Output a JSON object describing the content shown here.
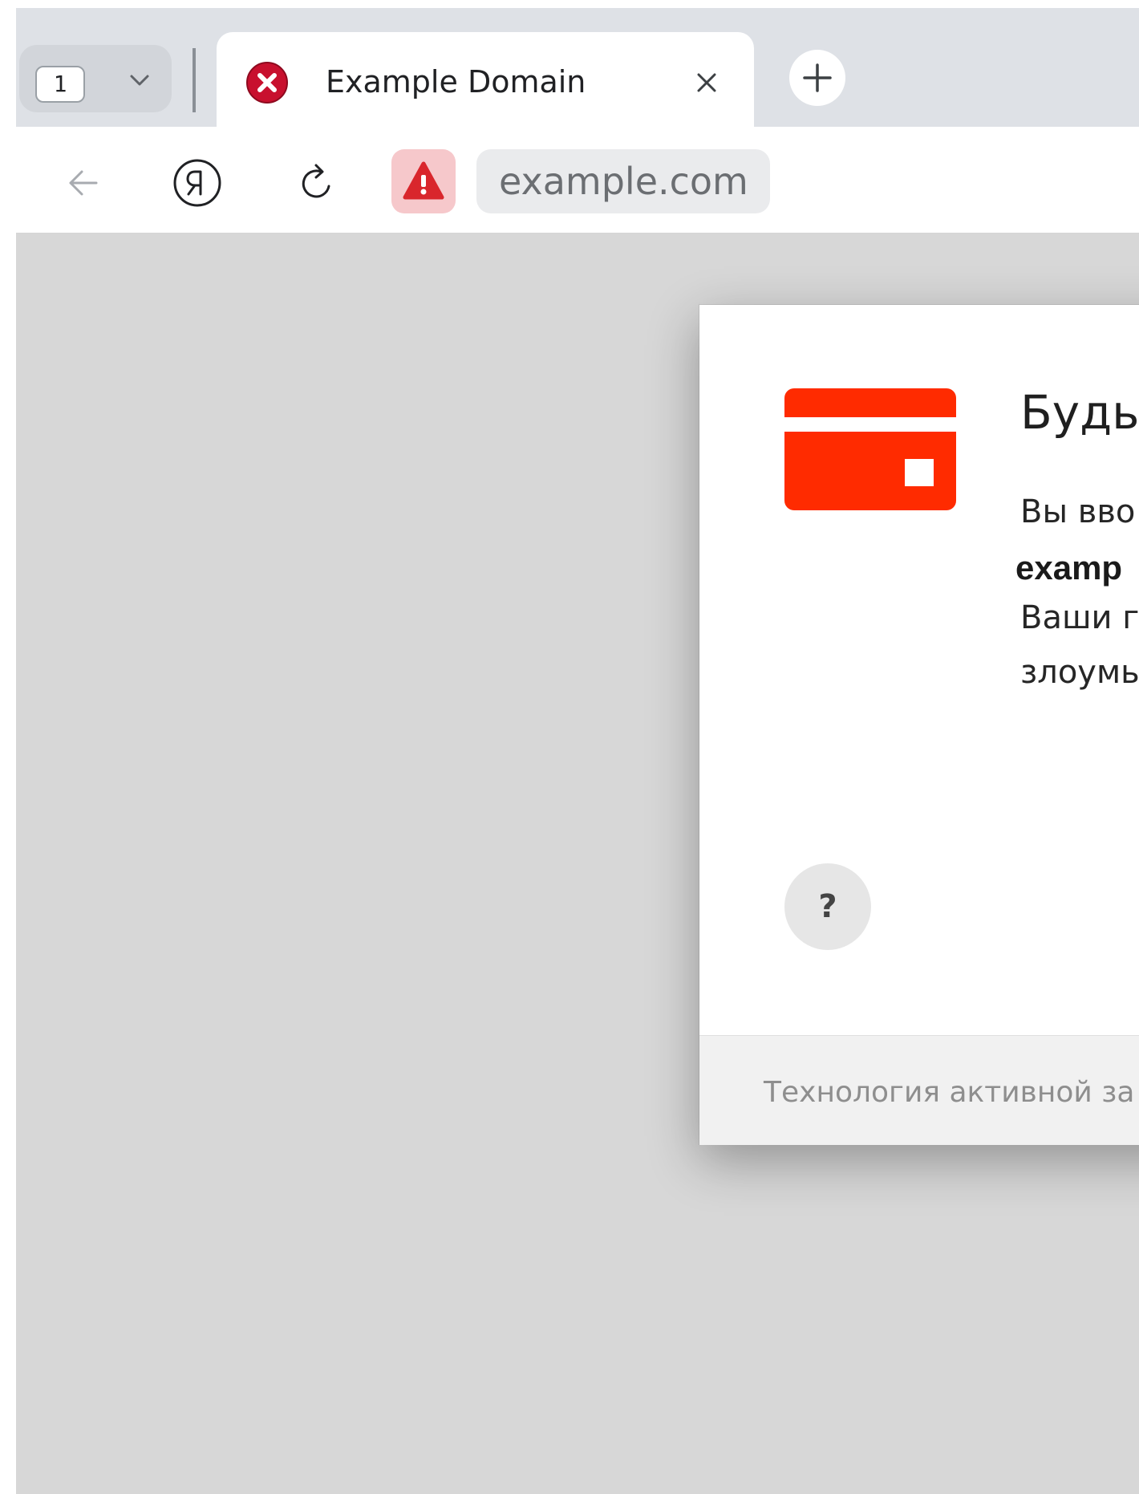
{
  "browser": {
    "tab_counter": "1",
    "tab": {
      "title": "Example Domain",
      "favicon": "error-icon"
    },
    "address_bar": {
      "url": "example.com",
      "security_indicator": "warning-icon"
    },
    "icons": [
      "back-arrow-icon",
      "yandex-logo-icon",
      "reload-icon",
      "plus-icon",
      "close-icon",
      "chevron-down-icon"
    ]
  },
  "dialog": {
    "icon": "credit-card-icon",
    "title": "Будьт",
    "lines": [
      "Вы вво",
      "Ваши г",
      "злоумы"
    ],
    "domain_fragment": "examp",
    "help_label": "?",
    "footer": "Технология активной за"
  },
  "colors": {
    "accent_red": "#ff2b00",
    "warning_red": "#d9262c",
    "page_background": "#d7d7d7"
  }
}
